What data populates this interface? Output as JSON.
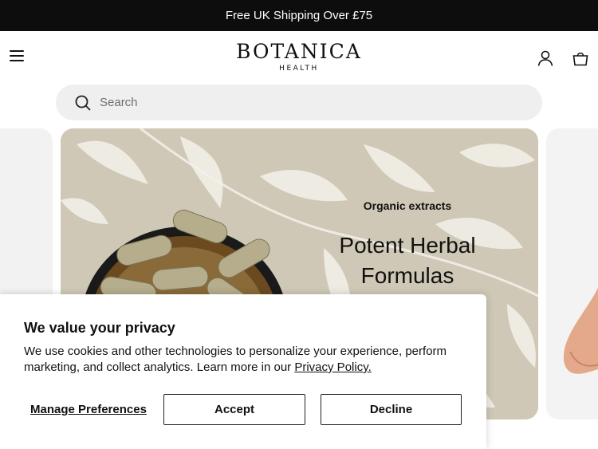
{
  "announcement": {
    "text": "Free UK Shipping Over £75"
  },
  "header": {
    "logo_main": "BOTANICA",
    "logo_sub": "HEALTH",
    "icons": [
      "menu-icon",
      "account-icon",
      "shopping-bag-icon"
    ]
  },
  "search": {
    "placeholder": "Search",
    "value": ""
  },
  "hero": {
    "eyebrow": "Organic extracts",
    "headline_line1": "Potent Herbal",
    "headline_line2": "Formulas"
  },
  "cookie": {
    "title": "We value your privacy",
    "body": "We use cookies and other technologies to personalize your experience, perform marketing, and collect analytics. Learn more in our ",
    "link": "Privacy Policy.",
    "manage": "Manage Preferences",
    "accept": "Accept",
    "decline": "Decline"
  },
  "colors": {
    "announcement_bg": "#0d0d0d",
    "hero_bg": "#cfc8b6",
    "search_bg": "#efefef"
  }
}
